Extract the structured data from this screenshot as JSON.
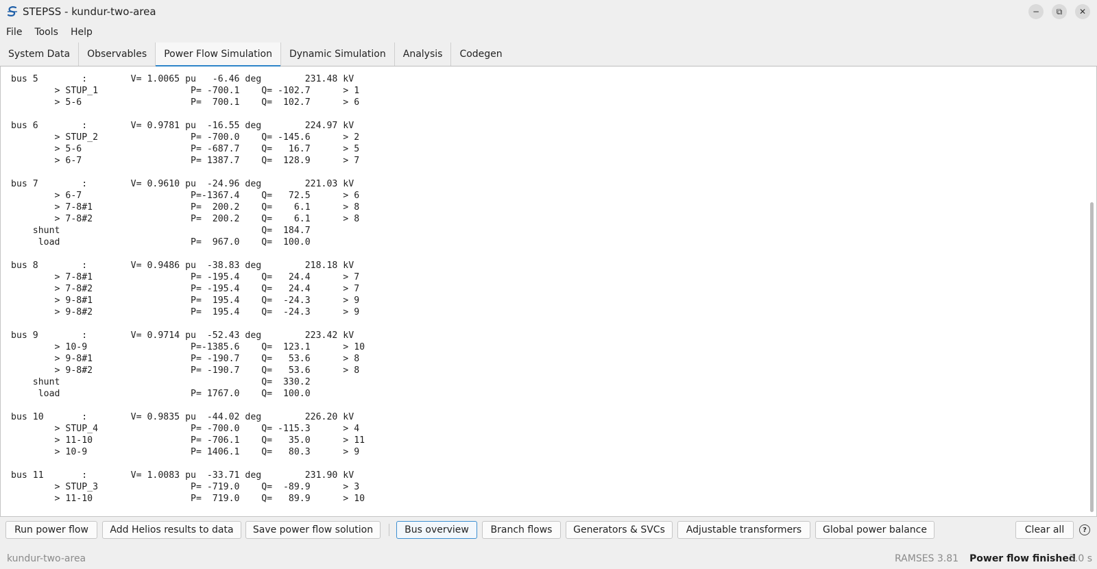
{
  "window": {
    "title": "STEPSS - kundur-two-area",
    "controls": {
      "minimize": "−",
      "restore": "⧉",
      "close": "✕"
    }
  },
  "menu": [
    "File",
    "Tools",
    "Help"
  ],
  "tabs": [
    {
      "label": "System Data",
      "active": false
    },
    {
      "label": "Observables",
      "active": false
    },
    {
      "label": "Power Flow Simulation",
      "active": true
    },
    {
      "label": "Dynamic Simulation",
      "active": false
    },
    {
      "label": "Analysis",
      "active": false
    },
    {
      "label": "Codegen",
      "active": false
    }
  ],
  "output": {
    "lines": [
      "bus 5        :        V= 1.0065 pu   -6.46 deg        231.48 kV",
      "        > STUP_1                 P= -700.1    Q= -102.7      > 1",
      "        > 5-6                    P=  700.1    Q=  102.7      > 6",
      "",
      "bus 6        :        V= 0.9781 pu  -16.55 deg        224.97 kV",
      "        > STUP_2                 P= -700.0    Q= -145.6      > 2",
      "        > 5-6                    P= -687.7    Q=   16.7      > 5",
      "        > 6-7                    P= 1387.7    Q=  128.9      > 7",
      "",
      "bus 7        :        V= 0.9610 pu  -24.96 deg        221.03 kV",
      "        > 6-7                    P=-1367.4    Q=   72.5      > 6",
      "        > 7-8#1                  P=  200.2    Q=    6.1      > 8",
      "        > 7-8#2                  P=  200.2    Q=    6.1      > 8",
      "    shunt                                     Q=  184.7",
      "     load                        P=  967.0    Q=  100.0",
      "",
      "bus 8        :        V= 0.9486 pu  -38.83 deg        218.18 kV",
      "        > 7-8#1                  P= -195.4    Q=   24.4      > 7",
      "        > 7-8#2                  P= -195.4    Q=   24.4      > 7",
      "        > 9-8#1                  P=  195.4    Q=  -24.3      > 9",
      "        > 9-8#2                  P=  195.4    Q=  -24.3      > 9",
      "",
      "bus 9        :        V= 0.9714 pu  -52.43 deg        223.42 kV",
      "        > 10-9                   P=-1385.6    Q=  123.1      > 10",
      "        > 9-8#1                  P= -190.7    Q=   53.6      > 8",
      "        > 9-8#2                  P= -190.7    Q=   53.6      > 8",
      "    shunt                                     Q=  330.2",
      "     load                        P= 1767.0    Q=  100.0",
      "",
      "bus 10       :        V= 0.9835 pu  -44.02 deg        226.20 kV",
      "        > STUP_4                 P= -700.0    Q= -115.3      > 4",
      "        > 11-10                  P= -706.1    Q=   35.0      > 11",
      "        > 10-9                   P= 1406.1    Q=   80.3      > 9",
      "",
      "bus 11       :        V= 1.0083 pu  -33.71 deg        231.90 kV",
      "        > STUP_3                 P= -719.0    Q=  -89.9      > 3",
      "        > 11-10                  P=  719.0    Q=   89.9      > 10"
    ]
  },
  "toolbar": {
    "run_power_flow": "Run power flow",
    "add_helios": "Add Helios results to data",
    "save_solution": "Save power flow solution",
    "bus_overview": "Bus overview",
    "branch_flows": "Branch flows",
    "generators_svcs": "Generators & SVCs",
    "adjustable_transformers": "Adjustable transformers",
    "global_power_balance": "Global power balance",
    "clear_all": "Clear all",
    "help": "?"
  },
  "status": {
    "project": "kundur-two-area",
    "version": "RAMSES 3.81",
    "state": "Power flow finished",
    "time": "3.0 s"
  },
  "colors": {
    "accent": "#2d84c9",
    "logo": "#1f5fa8"
  }
}
